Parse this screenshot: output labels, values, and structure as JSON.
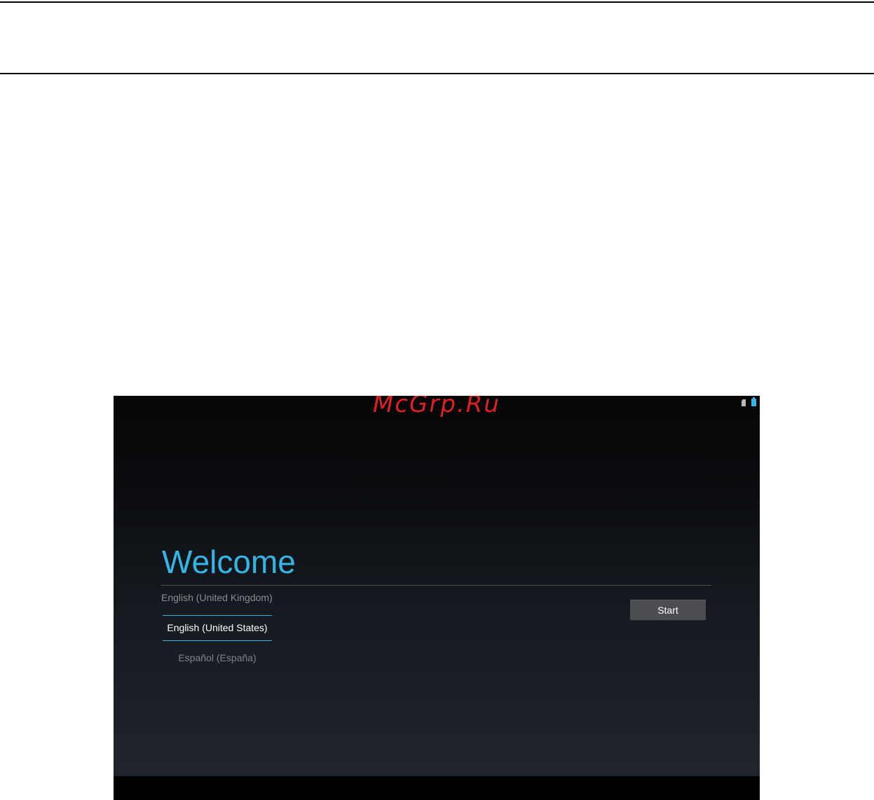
{
  "watermark": "McGrp.Ru",
  "status_bar": {
    "icons": [
      "sim-card-icon",
      "battery-icon"
    ],
    "accent_color": "#33b5e5"
  },
  "welcome": {
    "title": "Welcome"
  },
  "language_picker": {
    "items": [
      "English (United Kingdom)",
      "English (United States)",
      "Español (España)"
    ],
    "selected": "English (United States)"
  },
  "start_button": {
    "label": "Start"
  }
}
